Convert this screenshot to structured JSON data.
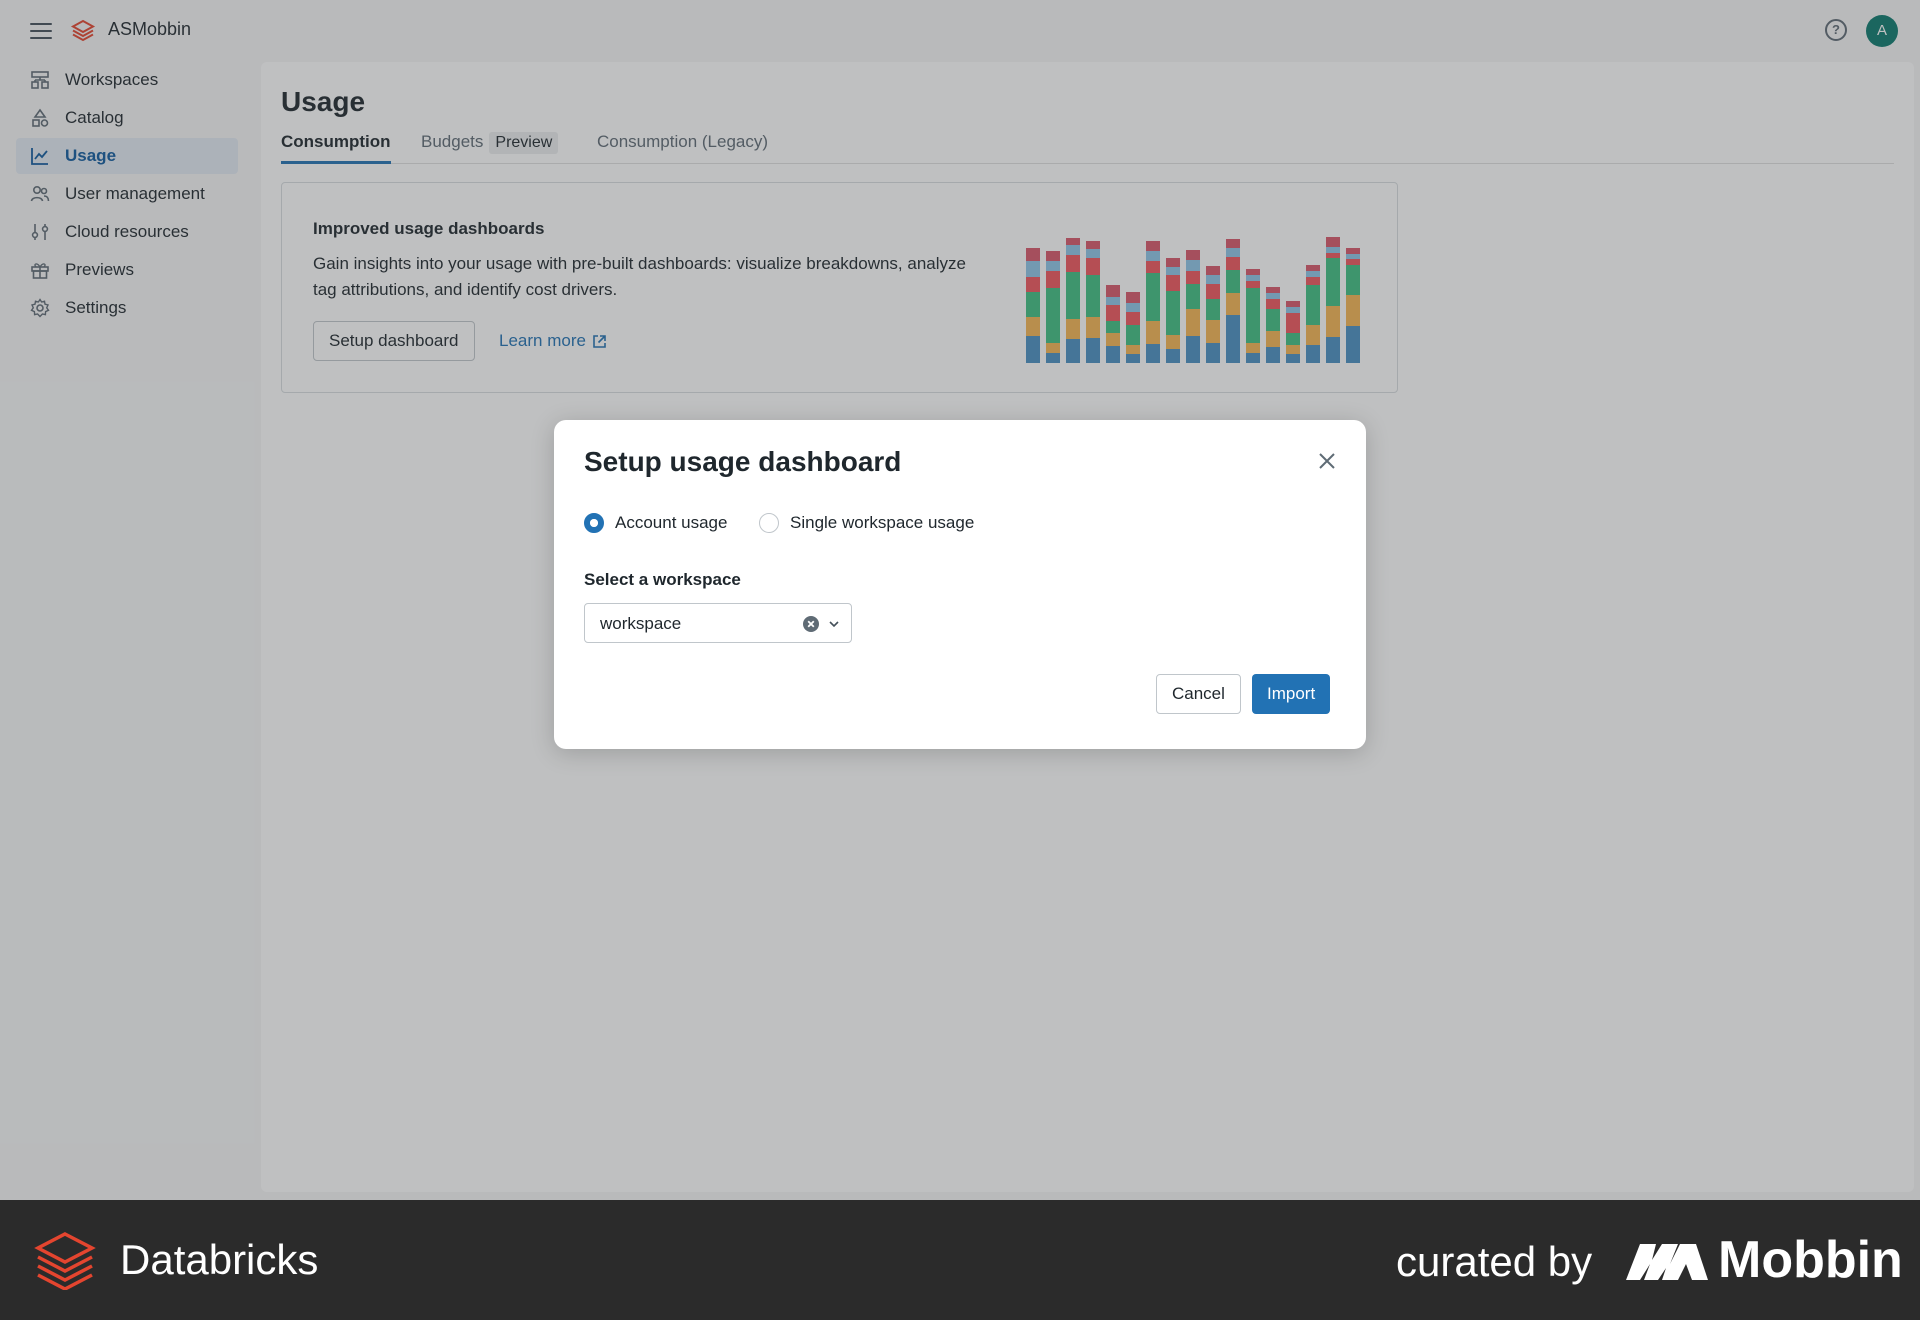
{
  "app": {
    "name": "ASMobbin",
    "avatar_initial": "A",
    "accent_color": "#2272b4",
    "avatar_color": "#0b7a6d"
  },
  "sidebar": {
    "items": [
      {
        "label": "Workspaces",
        "icon": "workspaces-icon"
      },
      {
        "label": "Catalog",
        "icon": "catalog-icon"
      },
      {
        "label": "Usage",
        "icon": "usage-chart-icon",
        "active": true
      },
      {
        "label": "User management",
        "icon": "users-icon"
      },
      {
        "label": "Cloud resources",
        "icon": "cloud-resources-icon"
      },
      {
        "label": "Previews",
        "icon": "gift-icon"
      },
      {
        "label": "Settings",
        "icon": "gear-icon"
      }
    ]
  },
  "page": {
    "title": "Usage",
    "tabs": [
      {
        "label": "Consumption",
        "active": true
      },
      {
        "label": "Budgets",
        "tag": "Preview"
      },
      {
        "label": "Consumption (Legacy)"
      }
    ]
  },
  "promo": {
    "title": "Improved usage dashboards",
    "description": "Gain insights into your usage with pre-built dashboards: visualize breakdowns, analyze tag attributions, and identify cost drivers.",
    "setup_button": "Setup dashboard",
    "learn_more": "Learn more"
  },
  "modal": {
    "title": "Setup usage dashboard",
    "radio_options": [
      {
        "label": "Account usage",
        "checked": true
      },
      {
        "label": "Single workspace usage",
        "checked": false
      }
    ],
    "field_label": "Select a workspace",
    "select_value": "workspace",
    "cancel_label": "Cancel",
    "import_label": "Import"
  },
  "footer": {
    "brand": "Databricks",
    "curated_by": "curated by",
    "mobbin": "Mobbin"
  }
}
